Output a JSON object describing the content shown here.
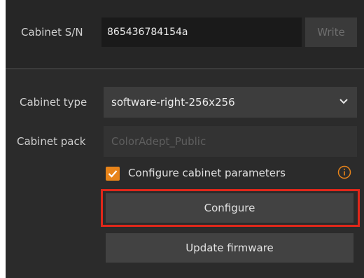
{
  "serial": {
    "label": "Cabinet S/N",
    "value": "865436784154a",
    "write_label": "Write"
  },
  "cabinet_type": {
    "label": "Cabinet type",
    "selected": "software-right-256x256",
    "chevron_icon": "chevron-down-icon"
  },
  "cabinet_pack": {
    "label": "Cabinet pack",
    "placeholder": "ColorAdept_Public"
  },
  "configure_params": {
    "label": "Configure cabinet parameters",
    "checked": true,
    "info_icon": "info-icon"
  },
  "buttons": {
    "configure_label": "Configure",
    "update_label": "Update firmware"
  },
  "colors": {
    "panel_bg": "#2b2b2b",
    "accent": "#e8841a",
    "highlight": "#e0271a"
  }
}
